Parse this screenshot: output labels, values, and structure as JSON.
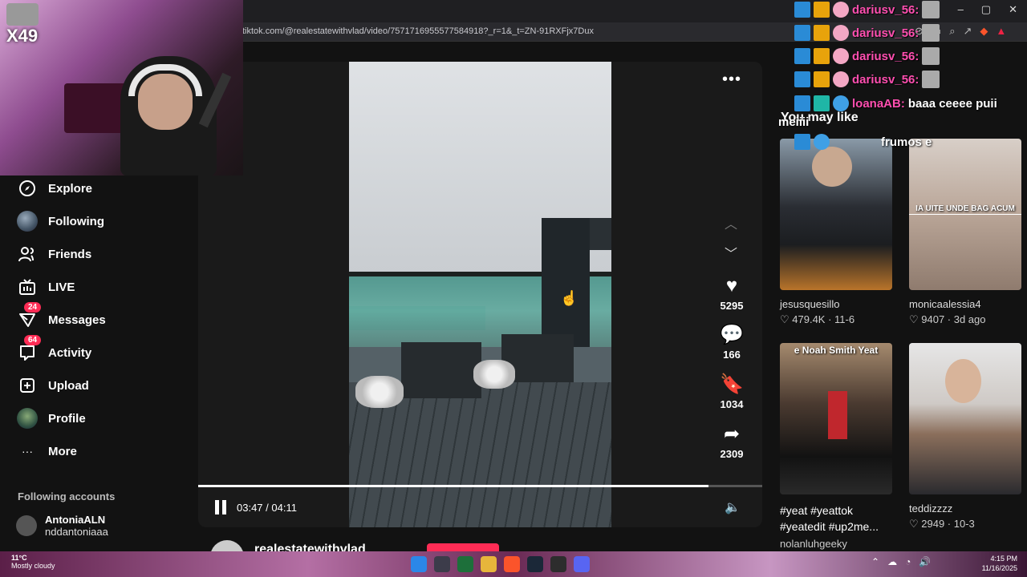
{
  "browser": {
    "url": "tiktok.com/@realestatewithvlad/video/7571716955577584918?_r=1&_t=ZN-91RXFjx7Dux",
    "window_controls": [
      "–",
      "▢",
      "✕"
    ]
  },
  "stream_overlay": {
    "badge": "X49",
    "chat": [
      {
        "user": "dariusv_56:",
        "text": ""
      },
      {
        "user": "dariusv_56:",
        "text": ""
      },
      {
        "user": "dariusv_56:",
        "text": ""
      },
      {
        "user": "dariusv_56:",
        "text": ""
      },
      {
        "user": "loanaAB:",
        "text": "baaa ceeee puii"
      },
      {
        "user": "",
        "text": "meiiii"
      },
      {
        "user": "",
        "text": "frumos e"
      }
    ]
  },
  "sidebar": {
    "items": [
      {
        "label": "Explore",
        "icon": "compass-icon"
      },
      {
        "label": "Following",
        "icon": "avatar"
      },
      {
        "label": "Friends",
        "icon": "friends-icon"
      },
      {
        "label": "LIVE",
        "icon": "live-tv-icon"
      },
      {
        "label": "Messages",
        "icon": "messages-icon",
        "badge": "24"
      },
      {
        "label": "Activity",
        "icon": "activity-icon",
        "badge": "64"
      },
      {
        "label": "Upload",
        "icon": "upload-icon"
      },
      {
        "label": "Profile",
        "icon": "avatar"
      },
      {
        "label": "More",
        "icon": "more-icon"
      }
    ],
    "following_accounts_title": "Following accounts",
    "accounts": [
      {
        "name": "AntoniaALN",
        "handle": "nddantoniaaa"
      }
    ]
  },
  "video": {
    "likes": "5295",
    "comments": "166",
    "saves": "1034",
    "shares": "2309",
    "current_time": "03:47",
    "duration": "04:11",
    "time_display": "03:47 / 04:11",
    "progress": 0.905,
    "author": "realestatewithvlad"
  },
  "recommendations": {
    "title": "You may like",
    "cards": [
      {
        "name": "jesusquesillo",
        "likes": "479.4K",
        "date": "11-6",
        "meta": "♡ 479.4K · 11-6",
        "overlay": ""
      },
      {
        "name": "monicaalessia4",
        "likes": "9407",
        "date": "3d ago",
        "meta": "♡ 9407 · 3d ago",
        "overlay": "IA UITE UNDE BAG ACUM"
      },
      {
        "name": "nolanluhgeeky",
        "caption": "#yeat #yeattok #yeatedit #up2me...",
        "top_text": "e Noah Smith Yeat"
      },
      {
        "name": "teddizzzz",
        "likes": "2949",
        "date": "10-3",
        "meta": "♡ 2949 · 10-3"
      }
    ]
  },
  "taskbar": {
    "temp": "11°C",
    "weather": "Mostly cloudy",
    "time": "4:15 PM",
    "date": "11/16/2025"
  },
  "colors": {
    "accent": "#fe2c55",
    "background": "#121212"
  }
}
